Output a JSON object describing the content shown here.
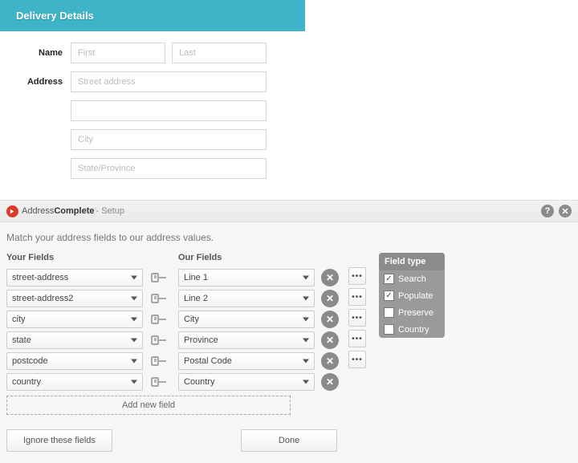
{
  "form": {
    "title": "Delivery Details",
    "labels": {
      "name": "Name",
      "address": "Address"
    },
    "placeholders": {
      "first": "First",
      "last": "Last",
      "street": "Street address",
      "city": "City",
      "state": "State/Province"
    }
  },
  "setup": {
    "brand_part1": "Address",
    "brand_part2": "Complete",
    "suffix": "- Setup",
    "help_glyph": "?",
    "close_glyph": "✕",
    "intro": "Match your address fields to our address values.",
    "headers": {
      "your": "Your Fields",
      "our": "Our Fields"
    },
    "rows": [
      {
        "your": "street-address",
        "our": "Line 1",
        "show_more": true
      },
      {
        "your": "street-address2",
        "our": "Line 2",
        "show_more": true
      },
      {
        "your": "city",
        "our": "City",
        "show_more": true
      },
      {
        "your": "state",
        "our": "Province",
        "show_more": true
      },
      {
        "your": "postcode",
        "our": "Postal Code",
        "show_more": true
      },
      {
        "your": "country",
        "our": "Country",
        "show_more": false
      }
    ],
    "delete_glyph": "✕",
    "more_glyph": "•••",
    "add_label": "Add new field",
    "fieldtype": {
      "title": "Field type",
      "options": [
        {
          "label": "Search",
          "checked": true
        },
        {
          "label": "Populate",
          "checked": true
        },
        {
          "label": "Preserve",
          "checked": false
        },
        {
          "label": "Country",
          "checked": false
        }
      ]
    },
    "buttons": {
      "ignore": "Ignore these fields",
      "done": "Done"
    }
  }
}
